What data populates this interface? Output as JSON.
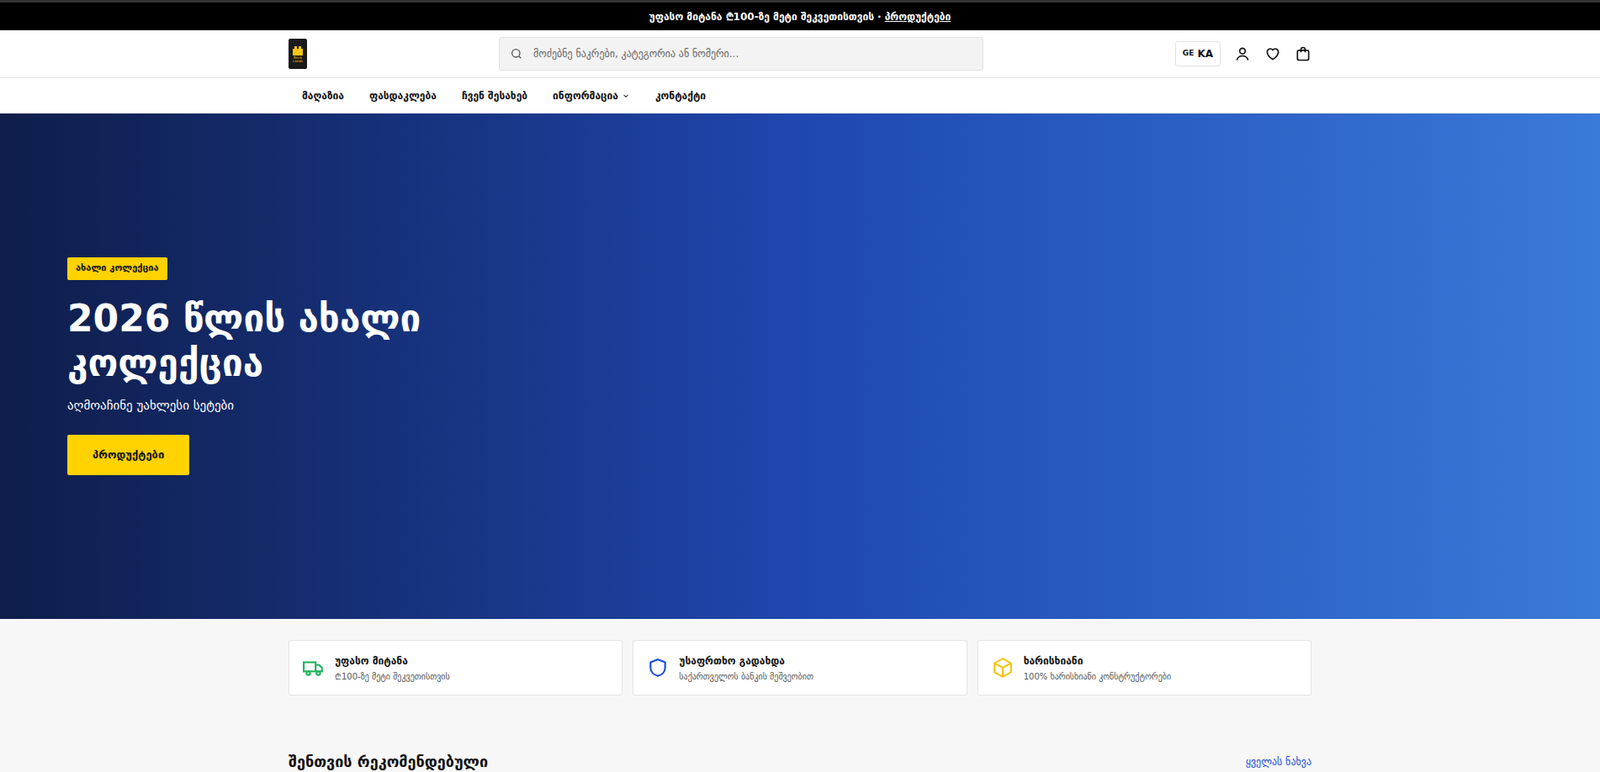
{
  "announcement": {
    "text": "უფასო მიტანა ₾100-ზე მეტი შეკვეთისთვის",
    "separator": "·",
    "link": "პროდუქტები"
  },
  "header": {
    "logo": "Brick Lands",
    "search": {
      "placeholder": "მოძებნე ნაკრები, კატეგორია ან ნომერი..."
    },
    "language": {
      "flag": "GE",
      "code": "KA"
    }
  },
  "nav": [
    {
      "label": "მაღაზია",
      "has_menu": false
    },
    {
      "label": "ფასდაკლება",
      "has_menu": false
    },
    {
      "label": "ჩვენ შესახებ",
      "has_menu": false
    },
    {
      "label": "ინფორმაცია",
      "has_menu": true
    },
    {
      "label": "კონტაქტი",
      "has_menu": false
    }
  ],
  "hero": {
    "badge": "ახალი კოლექცია",
    "title": "2026 წლის ახალი კოლექცია",
    "subtitle": "აღმოაჩინე უახლესი სეტები",
    "button": "პროდუქტები"
  },
  "features": [
    {
      "kind": "delivery",
      "title": "უფასო მიტანა",
      "subtitle": "₾100-ზე მეტი შეკვეთისთვის",
      "color": "#22b35e"
    },
    {
      "kind": "security",
      "title": "უსაფრთხო გადახდა",
      "subtitle": "საქართველოს ბანკის მეშვეობით",
      "color": "#1d4ed8"
    },
    {
      "kind": "quality",
      "title": "ხარისხიანი",
      "subtitle": "100% ხარისხიანი კონსტრუქტორები",
      "color": "#f5c518"
    }
  ],
  "section": {
    "title": "შენთვის რეკომენდებული",
    "link": "ყველას ნახვა"
  }
}
